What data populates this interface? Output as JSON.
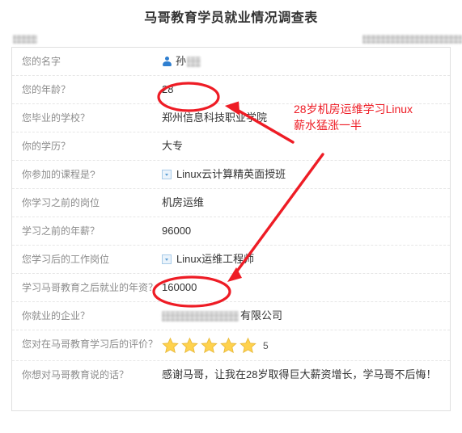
{
  "page": {
    "title": "马哥教育学员就业情况调查表",
    "accent_red": "#ee1c25",
    "star_color": "#ffd24d",
    "label_color": "#8c8c8c"
  },
  "meta": {
    "left_redacted": "",
    "right_redacted": ""
  },
  "rows": [
    {
      "label": "您的名字",
      "value": "孙",
      "type": "name",
      "has_person_icon": true,
      "redacted_suffix": true
    },
    {
      "label": "您的年龄？",
      "value": "28",
      "type": "text",
      "circled": true
    },
    {
      "label": "您毕业的学校？",
      "value": "郑州信息科技职业学院",
      "type": "text"
    },
    {
      "label": "你的学历？",
      "value": "大专",
      "type": "text"
    },
    {
      "label": "你参加的课程是?",
      "value": "Linux云计算精英面授班",
      "type": "select"
    },
    {
      "label": "你学习之前的岗位",
      "value": "机房运维",
      "type": "text"
    },
    {
      "label": "学习之前的年薪？",
      "value": "96000",
      "type": "text"
    },
    {
      "label": "您学习后的工作岗位",
      "value": "Linux运维工程师",
      "type": "select"
    },
    {
      "label": "学习马哥教育之后就业的年资？",
      "value": "160000",
      "type": "text",
      "circled": true
    },
    {
      "label": "你就业的企业？",
      "value": "有限公司",
      "type": "company",
      "redacted_prefix": true
    },
    {
      "label": "您对在马哥教育学习后的评价？",
      "value": "5",
      "type": "stars",
      "stars": 5
    },
    {
      "label": "你想对马哥教育说的话？",
      "value": "感谢马哥，让我在28岁取得巨大薪资增长，学马哥不后悔！",
      "type": "paragraph"
    }
  ],
  "annotation": {
    "line1": "28岁机房运维学习Linux",
    "line2": "薪水猛涨一半",
    "text": "28岁机房运维学习Linux\n薪水猛涨一半",
    "color": "#ee1c25",
    "highlights": [
      {
        "name": "age-circle",
        "target": "28"
      },
      {
        "name": "salary-circle",
        "target": "160000"
      }
    ]
  }
}
